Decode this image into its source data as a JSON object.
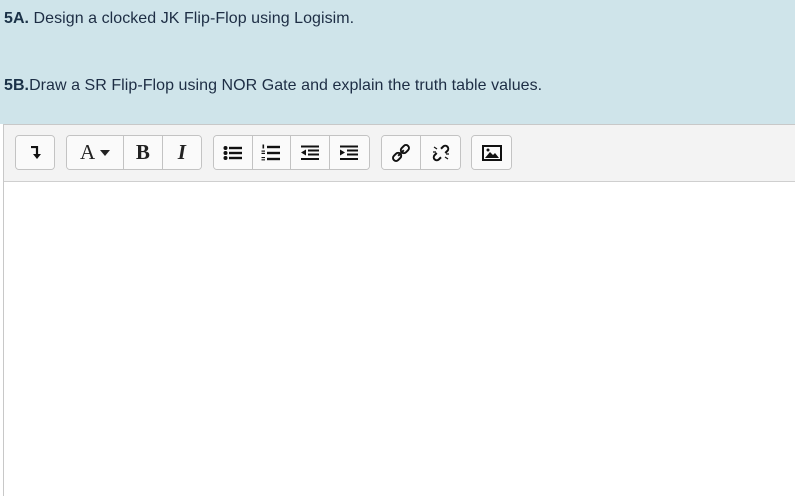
{
  "questions": {
    "q1": {
      "number": "5A.",
      "text": " Design a clocked JK Flip-Flop using Logisim."
    },
    "q2": {
      "number": "5B.",
      "text": "Draw a SR Flip-Flop using NOR Gate and explain the truth table values."
    }
  },
  "toolbar": {
    "font_label": "A",
    "bold_label": "B",
    "italic_label": "I",
    "icons": [
      "toolbar-toggle-icon",
      "font-color-icon",
      "bold-icon",
      "italic-icon",
      "unordered-list-icon",
      "ordered-list-icon",
      "outdent-icon",
      "indent-icon",
      "link-icon",
      "unlink-icon",
      "image-icon"
    ]
  },
  "editor": {
    "content": ""
  },
  "colors": {
    "question_bg": "#cfe4ea",
    "toolbar_bg": "#f3f3f3",
    "text": "#1d2d44"
  }
}
